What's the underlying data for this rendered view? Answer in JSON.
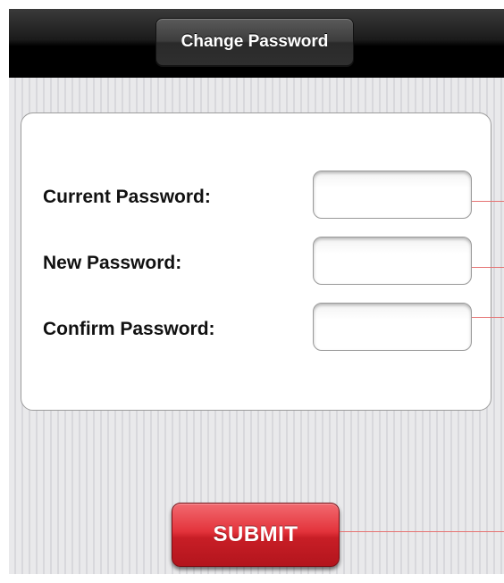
{
  "navbar": {
    "title": "Change Password"
  },
  "form": {
    "fields": [
      {
        "label": "Current Password:",
        "value": ""
      },
      {
        "label": "New Password:",
        "value": ""
      },
      {
        "label": "Confirm Password:",
        "value": ""
      }
    ]
  },
  "actions": {
    "submit_label": "SUBMIT"
  },
  "colors": {
    "submit_red": "#d3262e",
    "navbar_black": "#000000",
    "callout_line": "#e57373"
  }
}
